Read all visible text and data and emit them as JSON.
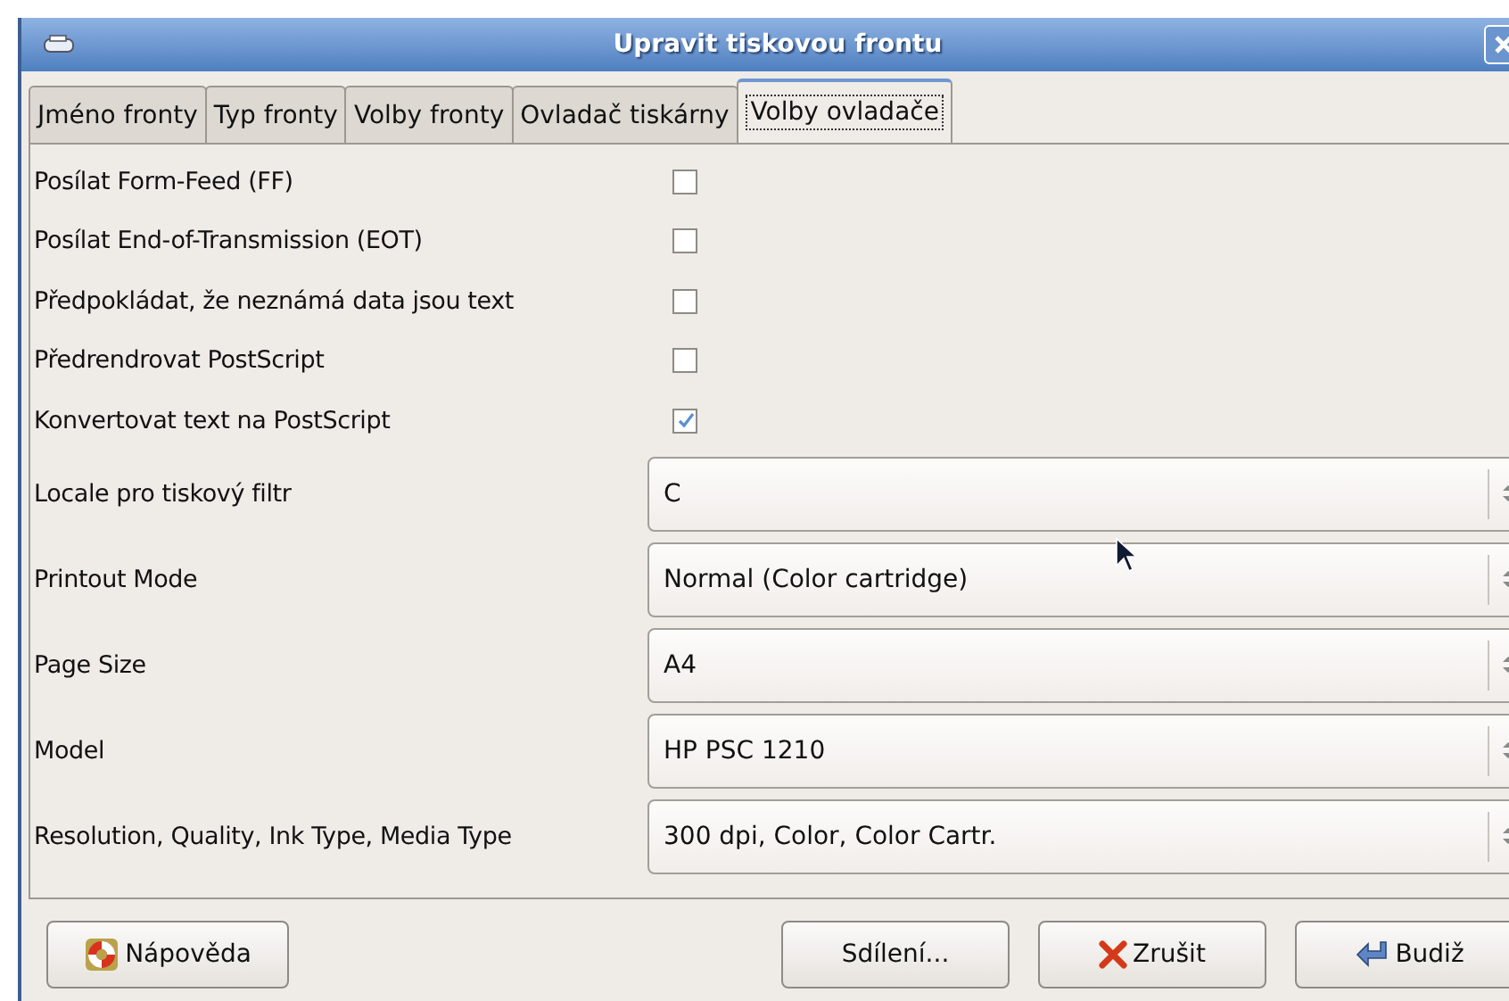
{
  "window": {
    "title": "Upravit tiskovou frontu"
  },
  "tabs": [
    {
      "label": "Jméno fronty",
      "selected": false
    },
    {
      "label": "Typ fronty",
      "selected": false
    },
    {
      "label": "Volby fronty",
      "selected": false
    },
    {
      "label": "Ovladač tiskárny",
      "selected": false
    },
    {
      "label": "Volby ovladače",
      "selected": true
    }
  ],
  "options": [
    {
      "kind": "checkbox",
      "label": "Posílat Form-Feed (FF)",
      "checked": false
    },
    {
      "kind": "checkbox",
      "label": "Posílat End-of-Transmission (EOT)",
      "checked": false
    },
    {
      "kind": "checkbox",
      "label": "Předpokládat, že neznámá data jsou text",
      "checked": false
    },
    {
      "kind": "checkbox",
      "label": "Předrendrovat PostScript",
      "checked": false
    },
    {
      "kind": "checkbox",
      "label": "Konvertovat text na PostScript",
      "checked": true
    },
    {
      "kind": "combo",
      "label": "Locale pro tiskový filtr",
      "value": "C"
    },
    {
      "kind": "combo",
      "label": "Printout Mode",
      "value": "Normal (Color cartridge)"
    },
    {
      "kind": "combo",
      "label": "Page Size",
      "value": "A4"
    },
    {
      "kind": "combo",
      "label": "Model",
      "value": "HP PSC 1210"
    },
    {
      "kind": "combo",
      "label": "Resolution, Quality, Ink Type, Media Type",
      "value": "300 dpi, Color, Color Cartr."
    }
  ],
  "buttons": [
    {
      "kind": "help",
      "label": "Nápověda"
    },
    {
      "kind": "share",
      "label": "Sdílení..."
    },
    {
      "kind": "cancel",
      "label": "Zrušit"
    },
    {
      "kind": "ok",
      "label": "Budiž"
    }
  ]
}
